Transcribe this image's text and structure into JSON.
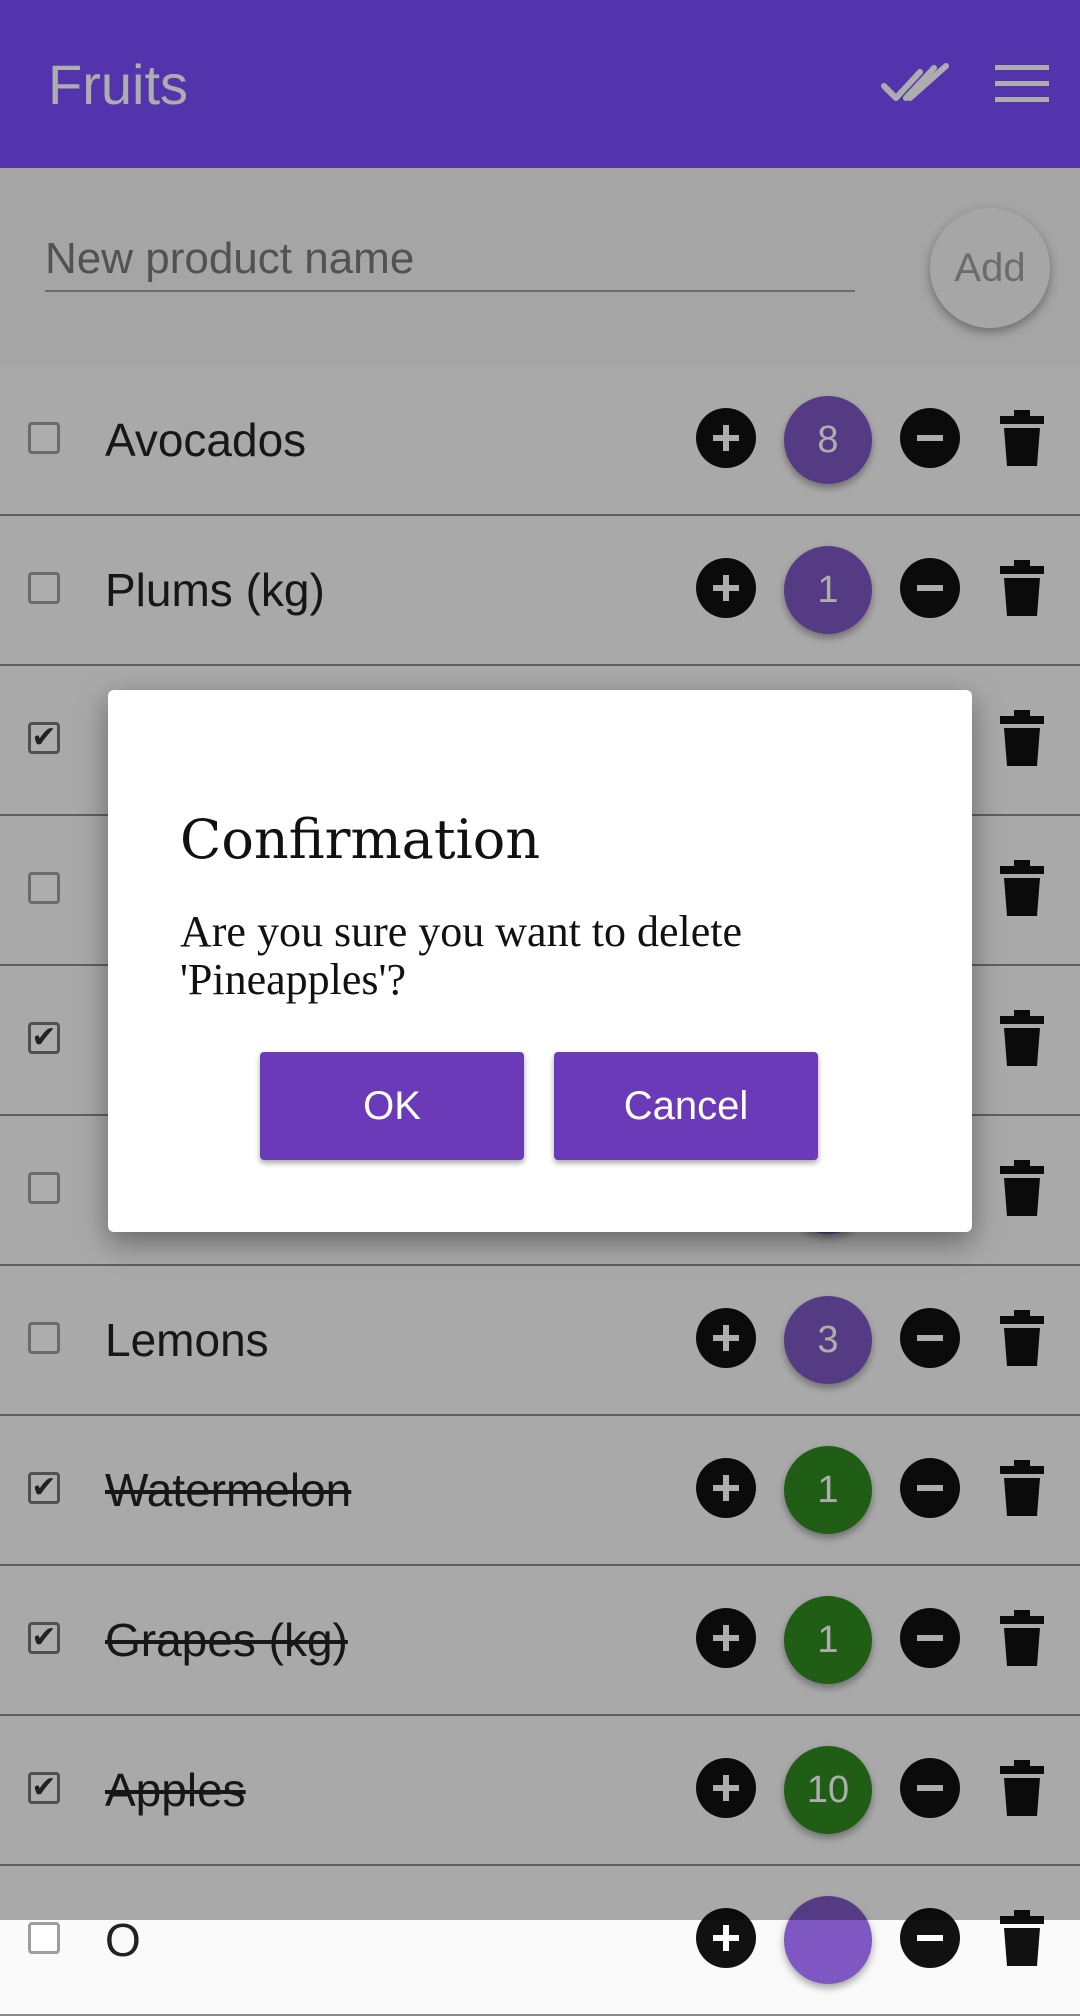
{
  "app_bar": {
    "title": "Fruits"
  },
  "new_product": {
    "placeholder": "New product name",
    "add_label": "Add"
  },
  "items": [
    {
      "name": "Avocados",
      "qty": "8",
      "checked": false,
      "qty_color": "#7e57c2"
    },
    {
      "name": "Plums (kg)",
      "qty": "1",
      "checked": false,
      "qty_color": "#7e57c2"
    },
    {
      "name": "",
      "qty": "",
      "checked": true,
      "qty_color": "#7e57c2"
    },
    {
      "name": "",
      "qty": "",
      "checked": false,
      "qty_color": "#7e57c2"
    },
    {
      "name": "",
      "qty": "",
      "checked": true,
      "qty_color": "#7e57c2"
    },
    {
      "name": "",
      "qty": "",
      "checked": false,
      "qty_color": "#7e57c2"
    },
    {
      "name": "Lemons",
      "qty": "3",
      "checked": false,
      "qty_color": "#7e57c2"
    },
    {
      "name": "Watermelon",
      "qty": "1",
      "checked": true,
      "qty_color": "#2e8b1e"
    },
    {
      "name": "Grapes (kg)",
      "qty": "1",
      "checked": true,
      "qty_color": "#2e8b1e"
    },
    {
      "name": "Apples",
      "qty": "10",
      "checked": true,
      "qty_color": "#2e8b1e"
    },
    {
      "name": "O",
      "qty": "",
      "checked": false,
      "qty_color": "#7e57c2"
    }
  ],
  "dialog": {
    "title": "Confirmation",
    "message": "Are you sure you want to delete 'Pineapples'?",
    "ok_label": "OK",
    "cancel_label": "Cancel"
  },
  "icons": {
    "check_all": "done-all-icon",
    "menu": "hamburger-menu-icon",
    "plus": "plus-circle-icon",
    "minus": "minus-circle-icon",
    "trash": "trash-icon"
  },
  "colors": {
    "app_bar": "#7c4dff",
    "dialog_button": "#6a3ab8",
    "pending_qty": "#7e57c2",
    "done_qty": "#2e8b1e"
  }
}
